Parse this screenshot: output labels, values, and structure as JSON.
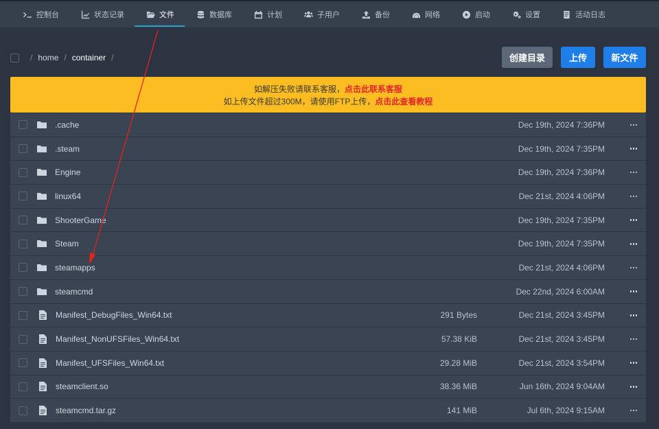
{
  "nav": {
    "tabs": [
      {
        "label": "控制台",
        "icon": "terminal-icon"
      },
      {
        "label": "状态记录",
        "icon": "chart-icon"
      },
      {
        "label": "文件",
        "icon": "folder-open-icon",
        "active": true
      },
      {
        "label": "数据库",
        "icon": "database-icon"
      },
      {
        "label": "计划",
        "icon": "calendar-icon"
      },
      {
        "label": "子用户",
        "icon": "users-icon"
      },
      {
        "label": "备份",
        "icon": "upload-icon"
      },
      {
        "label": "网络",
        "icon": "network-icon"
      },
      {
        "label": "启动",
        "icon": "play-icon"
      },
      {
        "label": "设置",
        "icon": "gear-icon"
      },
      {
        "label": "活动日志",
        "icon": "log-icon"
      }
    ]
  },
  "breadcrumb": {
    "sep": "/",
    "parts": [
      "home",
      "container"
    ]
  },
  "actions": {
    "create_dir": "创建目录",
    "upload": "上传",
    "new_file": "新文件"
  },
  "notice": {
    "line1_text": "如解压失败请联系客服，",
    "line1_link": "点击此联系客服",
    "line2_text": "如上传文件超过300M，请使用FTP上传，",
    "line2_link": "点击此查看教程"
  },
  "files": [
    {
      "name": ".cache",
      "type": "folder",
      "size": "",
      "date": "Dec 19th, 2024 7:36PM"
    },
    {
      "name": ".steam",
      "type": "folder",
      "size": "",
      "date": "Dec 19th, 2024 7:35PM"
    },
    {
      "name": "Engine",
      "type": "folder",
      "size": "",
      "date": "Dec 19th, 2024 7:36PM"
    },
    {
      "name": "linux64",
      "type": "folder",
      "size": "",
      "date": "Dec 21st, 2024 4:06PM"
    },
    {
      "name": "ShooterGame",
      "type": "folder",
      "size": "",
      "date": "Dec 19th, 2024 7:35PM"
    },
    {
      "name": "Steam",
      "type": "folder",
      "size": "",
      "date": "Dec 19th, 2024 7:35PM"
    },
    {
      "name": "steamapps",
      "type": "folder",
      "size": "",
      "date": "Dec 21st, 2024 4:06PM"
    },
    {
      "name": "steamcmd",
      "type": "folder",
      "size": "",
      "date": "Dec 22nd, 2024 6:00AM"
    },
    {
      "name": "Manifest_DebugFiles_Win64.txt",
      "type": "file",
      "size": "291 Bytes",
      "date": "Dec 21st, 2024 3:45PM"
    },
    {
      "name": "Manifest_NonUFSFiles_Win64.txt",
      "type": "file",
      "size": "57.38 KiB",
      "date": "Dec 21st, 2024 3:45PM"
    },
    {
      "name": "Manifest_UFSFiles_Win64.txt",
      "type": "file",
      "size": "29.28 MiB",
      "date": "Dec 21st, 2024 3:54PM"
    },
    {
      "name": "steamclient.so",
      "type": "file",
      "size": "38.36 MiB",
      "date": "Jun 16th, 2024 9:04AM"
    },
    {
      "name": "steamcmd.tar.gz",
      "type": "file",
      "size": "141 MiB",
      "date": "Jul 6th, 2024 9:15AM"
    }
  ],
  "colors": {
    "accent": "#2aa3c6",
    "notice_bg": "#fbbd22",
    "notice_link": "#e42828",
    "primary_button": "#1f7ee8",
    "annotation_arrow": "#e8231c"
  }
}
